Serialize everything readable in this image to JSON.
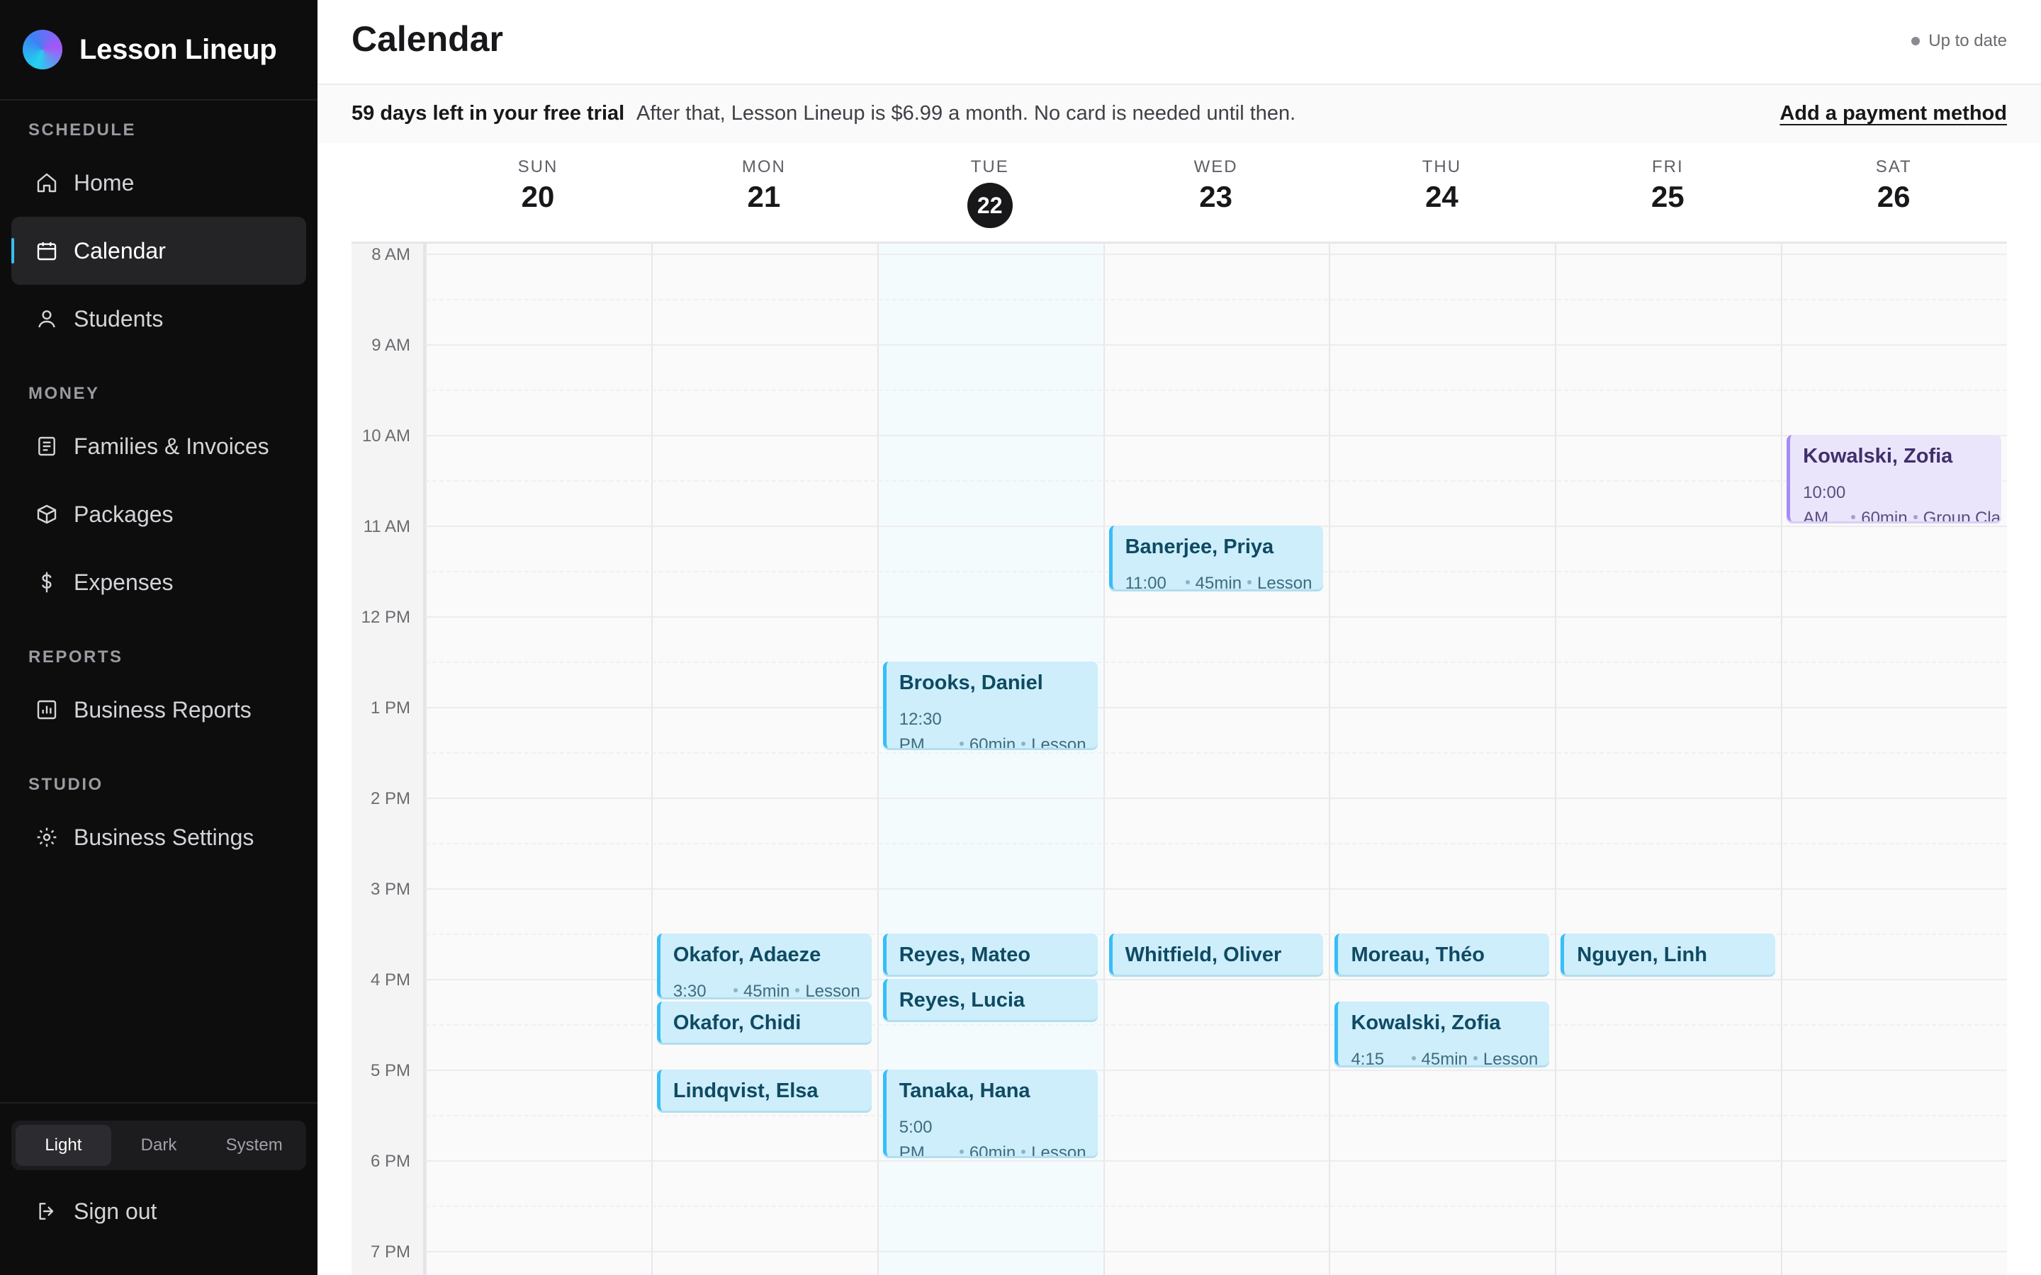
{
  "app": {
    "name": "Lesson Lineup"
  },
  "sidebar": {
    "sections": [
      {
        "label": "SCHEDULE"
      },
      {
        "label": "MONEY"
      },
      {
        "label": "REPORTS"
      },
      {
        "label": "STUDIO"
      }
    ],
    "items": [
      {
        "label": "Home",
        "icon": "home-icon"
      },
      {
        "label": "Calendar",
        "icon": "calendar-icon",
        "active": true
      },
      {
        "label": "Students",
        "icon": "user-icon"
      },
      {
        "label": "Families & Invoices",
        "icon": "invoice-icon"
      },
      {
        "label": "Packages",
        "icon": "package-icon"
      },
      {
        "label": "Expenses",
        "icon": "dollar-icon"
      },
      {
        "label": "Business Reports",
        "icon": "chart-icon"
      },
      {
        "label": "Business Settings",
        "icon": "gear-icon"
      }
    ],
    "theme": {
      "options": [
        "Light",
        "Dark",
        "System"
      ],
      "selected": "Light"
    },
    "sign_out": "Sign out"
  },
  "header": {
    "title": "Calendar",
    "status": "Up to date"
  },
  "trial": {
    "headline": "59 days left in your free trial",
    "text": "After that, Lesson Lineup is $6.99 a month. No card is needed until then.",
    "link": "Add a payment method"
  },
  "calendar": {
    "days": [
      {
        "name": "SUN",
        "num": "20"
      },
      {
        "name": "MON",
        "num": "21"
      },
      {
        "name": "TUE",
        "num": "22",
        "today": true
      },
      {
        "name": "WED",
        "num": "23"
      },
      {
        "name": "THU",
        "num": "24"
      },
      {
        "name": "FRI",
        "num": "25"
      },
      {
        "name": "SAT",
        "num": "26"
      }
    ],
    "hours": [
      "8 AM",
      "9 AM",
      "10 AM",
      "11 AM",
      "12 PM",
      "1 PM",
      "2 PM",
      "3 PM",
      "4 PM",
      "5 PM",
      "6 PM",
      "7 PM"
    ],
    "events": [
      {
        "day": 1,
        "start": 15.5,
        "end": 16.25,
        "name": "Okafor, Adaeze",
        "time": "3:30",
        "duration": "45min",
        "kind": "Lesson"
      },
      {
        "day": 1,
        "start": 16.25,
        "end": 16.75,
        "name": "Okafor, Chidi"
      },
      {
        "day": 1,
        "start": 17.0,
        "end": 17.5,
        "name": "Lindqvist, Elsa"
      },
      {
        "day": 2,
        "start": 12.5,
        "end": 13.5,
        "name": "Brooks, Daniel",
        "time": "12:30 PM",
        "duration": "60min",
        "kind": "Lesson"
      },
      {
        "day": 2,
        "start": 15.5,
        "end": 16.0,
        "name": "Reyes, Mateo"
      },
      {
        "day": 2,
        "start": 16.0,
        "end": 16.5,
        "name": "Reyes, Lucia"
      },
      {
        "day": 2,
        "start": 17.0,
        "end": 18.0,
        "name": "Tanaka, Hana",
        "time": "5:00 PM",
        "duration": "60min",
        "kind": "Lesson"
      },
      {
        "day": 3,
        "start": 11.0,
        "end": 11.75,
        "name": "Banerjee, Priya",
        "time": "11:00",
        "duration": "45min",
        "kind": "Lesson"
      },
      {
        "day": 3,
        "start": 15.5,
        "end": 16.0,
        "name": "Whitfield, Oliver"
      },
      {
        "day": 4,
        "start": 15.5,
        "end": 16.0,
        "name": "Moreau, Théo"
      },
      {
        "day": 4,
        "start": 16.25,
        "end": 17.0,
        "name": "Kowalski, Zofia",
        "time": "4:15",
        "duration": "45min",
        "kind": "Lesson"
      },
      {
        "day": 5,
        "start": 15.5,
        "end": 16.0,
        "name": "Nguyen, Linh"
      },
      {
        "day": 6,
        "start": 10.0,
        "end": 11.0,
        "name": "Kowalski, Zofia",
        "time": "10:00 AM",
        "duration": "60min",
        "kind": "Group Class",
        "group": true
      }
    ]
  }
}
